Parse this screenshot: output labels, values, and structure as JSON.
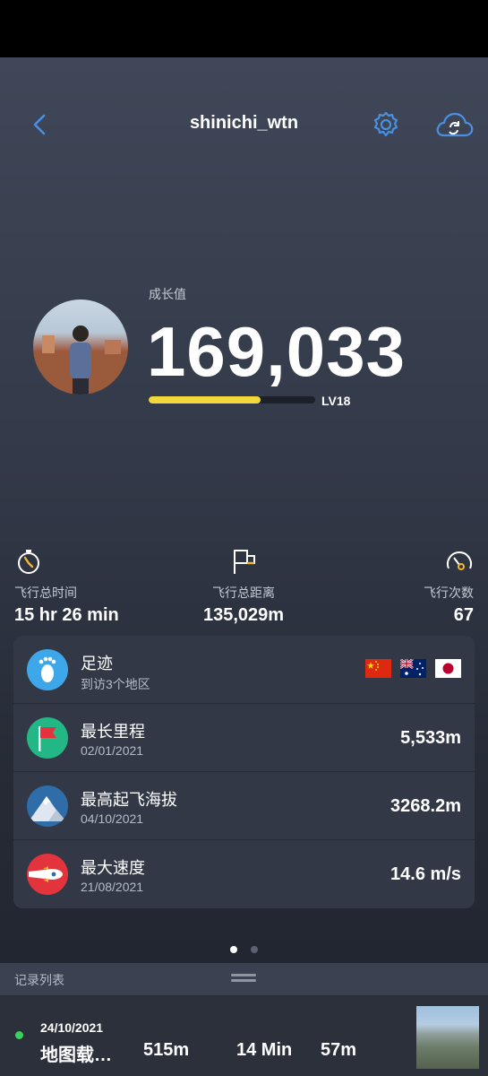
{
  "header": {
    "title": "shinichi_wtn",
    "back_icon": "chevron-left-icon",
    "settings_icon": "gear-icon",
    "sync_icon": "cloud-sync-icon"
  },
  "growth": {
    "label": "成长值",
    "value": "169,033",
    "level": "LV18",
    "level_progress": 0.67,
    "bar_color": "#f2d83a"
  },
  "stats": {
    "time": {
      "label": "飞行总时间",
      "value": "15 hr 26 min",
      "icon": "stopwatch-icon"
    },
    "distance": {
      "label": "飞行总距离",
      "value": "135,029m",
      "icon": "flag-icon"
    },
    "count": {
      "label": "飞行次数",
      "value": "67",
      "icon": "speedometer-icon"
    }
  },
  "achievements": [
    {
      "title": "足迹",
      "subtitle": "到访3个地区",
      "icon": "footprint-icon",
      "icon_color": "#3ea7ea",
      "flags": [
        "china-flag-icon",
        "australia-flag-icon",
        "japan-flag-icon"
      ]
    },
    {
      "title": "最长里程",
      "subtitle": "02/01/2021",
      "value": "5,533m",
      "icon": "red-flag-icon",
      "icon_color": "#23b785"
    },
    {
      "title": "最高起飞海拔",
      "subtitle": "04/10/2021",
      "value": "3268.2m",
      "icon": "mountain-icon",
      "icon_color": "#2e6da8"
    },
    {
      "title": "最大速度",
      "subtitle": "21/08/2021",
      "value": "14.6 m/s",
      "icon": "rocket-icon",
      "icon_color": "#e3343d"
    }
  ],
  "pager": {
    "pages": 2,
    "active": 1
  },
  "records": {
    "label": "记录列表",
    "items": [
      {
        "date": "24/10/2021",
        "name": "地图载…",
        "distance": "515m",
        "duration": "14 Min",
        "altitude": "57m",
        "status_color": "#37d25a"
      }
    ]
  }
}
